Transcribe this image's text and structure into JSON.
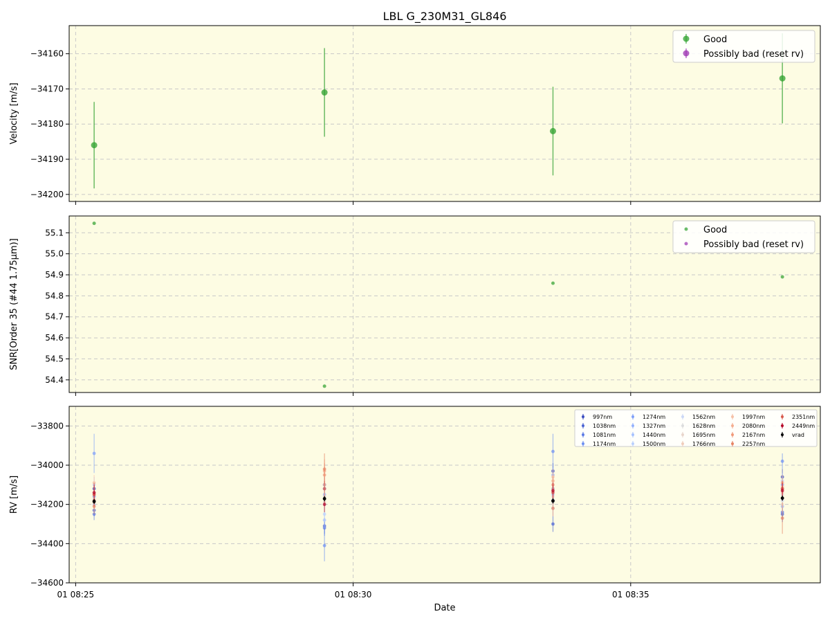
{
  "title": "LBL G_230M31_GL846",
  "xlabel": "Date",
  "x_ticks": [
    "01 08:25",
    "01 08:30",
    "01 08:35"
  ],
  "colors": {
    "background": "#fdfce3",
    "good": "#2ca02c",
    "bad": "#9b30b0",
    "vrad": "#000000",
    "grid": "#c8c8c8"
  },
  "chart_data": [
    {
      "type": "scatter",
      "ylabel": "Velocity [m/s]",
      "ylim": [
        -34202,
        -34152
      ],
      "yticks": [
        -34200,
        -34190,
        -34180,
        -34170,
        -34160
      ],
      "ytick_labels": [
        "−34200",
        "−34190",
        "−34180",
        "−34170",
        "−34160"
      ],
      "grid": true,
      "legend_position": "upper right",
      "legend": [
        "Good",
        "Possibly bad (reset rv)"
      ],
      "series": [
        {
          "name": "Good",
          "x": [
            "08:25:20",
            "08:29:29",
            "08:33:36",
            "08:37:44"
          ],
          "y": [
            -34186,
            -34171,
            -34182,
            -34167
          ],
          "yerr": [
            12.3,
            12.6,
            12.6,
            12.8
          ]
        },
        {
          "name": "Possibly bad (reset rv)",
          "x": [],
          "y": [],
          "yerr": []
        }
      ]
    },
    {
      "type": "scatter",
      "ylabel": "SNR[Order 35 (#44 1.75μm)]",
      "ylim": [
        54.34,
        55.18
      ],
      "yticks": [
        54.4,
        54.5,
        54.6,
        54.7,
        54.8,
        54.9,
        55.0,
        55.1
      ],
      "ytick_labels": [
        "54.4",
        "54.5",
        "54.6",
        "54.7",
        "54.8",
        "54.9",
        "55.0",
        "55.1"
      ],
      "grid": true,
      "legend_position": "upper right",
      "legend": [
        "Good",
        "Possibly bad (reset rv)"
      ],
      "series": [
        {
          "name": "Good",
          "x": [
            "08:25:20",
            "08:29:29",
            "08:33:36",
            "08:37:44"
          ],
          "y": [
            55.145,
            54.37,
            54.86,
            54.89
          ]
        },
        {
          "name": "Possibly bad (reset rv)",
          "x": [],
          "y": []
        }
      ]
    },
    {
      "type": "scatter",
      "ylabel": "RV [m/s]",
      "ylim": [
        -34600,
        -33700
      ],
      "yticks": [
        -34600,
        -34400,
        -34200,
        -34000,
        -33800
      ],
      "ytick_labels": [
        "−34600",
        "−34400",
        "−34200",
        "−34000",
        "−33800"
      ],
      "grid": true,
      "legend_position": "upper right",
      "legend_columns": 5,
      "x": [
        "08:25:20",
        "08:29:29",
        "08:33:36",
        "08:37:44"
      ],
      "series": [
        {
          "name": "997nm",
          "color": "#3a4cc0",
          "y": [
            -34120,
            -34100,
            -34030,
            -34060
          ],
          "yerr": [
            30,
            40,
            40,
            40
          ]
        },
        {
          "name": "1038nm",
          "color": "#4a63d3",
          "y": [
            -34230,
            -34310,
            -34300,
            -34250
          ],
          "yerr": [
            30,
            40,
            40,
            40
          ]
        },
        {
          "name": "1081nm",
          "color": "#5b7ae5",
          "y": [
            -34250,
            -34320,
            -34120,
            -34240
          ],
          "yerr": [
            30,
            40,
            40,
            40
          ]
        },
        {
          "name": "1174nm",
          "color": "#6c8ff2",
          "y": [
            -34160,
            -34410,
            -33930,
            -33980
          ],
          "yerr": [
            30,
            80,
            90,
            40
          ]
        },
        {
          "name": "1274nm",
          "color": "#7fa0f9",
          "y": [
            -33940,
            -34120,
            -34180,
            -34100
          ],
          "yerr": [
            100,
            40,
            40,
            40
          ]
        },
        {
          "name": "1327nm",
          "color": "#93b1fd",
          "y": [
            -34180,
            -34150,
            -34050,
            -34210
          ],
          "yerr": [
            40,
            40,
            40,
            40
          ]
        },
        {
          "name": "1440nm",
          "color": "#a6c1ff",
          "y": [
            -34200,
            -34280,
            -34150,
            -34120
          ],
          "yerr": [
            40,
            40,
            40,
            40
          ]
        },
        {
          "name": "1500nm",
          "color": "#b9d0fd",
          "y": [
            -34100,
            -34250,
            -34220,
            -34080
          ],
          "yerr": [
            40,
            40,
            40,
            40
          ]
        },
        {
          "name": "1562nm",
          "color": "#cbd8f6",
          "y": [
            -34150,
            -34200,
            -34140,
            -34180
          ],
          "yerr": [
            40,
            40,
            40,
            40
          ]
        },
        {
          "name": "1628nm",
          "color": "#dcdddd",
          "y": [
            -34170,
            -34160,
            -34190,
            -34150
          ],
          "yerr": [
            40,
            40,
            40,
            40
          ]
        },
        {
          "name": "1695nm",
          "color": "#e8d6cc",
          "y": [
            -34140,
            -34190,
            -34160,
            -34200
          ],
          "yerr": [
            40,
            40,
            40,
            40
          ]
        },
        {
          "name": "1766nm",
          "color": "#f0cdbb",
          "y": [
            -34190,
            -34170,
            -34120,
            -34140
          ],
          "yerr": [
            40,
            40,
            40,
            40
          ]
        },
        {
          "name": "1997nm",
          "color": "#f5c0a6",
          "y": [
            -34090,
            -34100,
            -34060,
            -34110
          ],
          "yerr": [
            40,
            40,
            40,
            40
          ]
        },
        {
          "name": "2080nm",
          "color": "#f4ad8f",
          "y": [
            -34150,
            -34030,
            -34080,
            -34090
          ],
          "yerr": [
            40,
            60,
            40,
            40
          ]
        },
        {
          "name": "2167nm",
          "color": "#f09979",
          "y": [
            -34180,
            -34050,
            -34100,
            -34120
          ],
          "yerr": [
            40,
            60,
            40,
            40
          ]
        },
        {
          "name": "2257nm",
          "color": "#e68364",
          "y": [
            -34210,
            -34020,
            -34220,
            -34270
          ],
          "yerr": [
            40,
            80,
            40,
            80
          ]
        },
        {
          "name": "2351nm",
          "color": "#d8594b",
          "y": [
            -34150,
            -34120,
            -34140,
            -34120
          ],
          "yerr": [
            60,
            40,
            40,
            40
          ]
        },
        {
          "name": "2449nm",
          "color": "#b40426",
          "y": [
            -34140,
            -34200,
            -34130,
            -34130
          ],
          "yerr": [
            40,
            40,
            40,
            40
          ]
        },
        {
          "name": "vrad",
          "color": "#000000",
          "y": [
            -34185,
            -34171,
            -34182,
            -34168
          ],
          "yerr": [
            12,
            13,
            13,
            13
          ]
        }
      ]
    }
  ]
}
